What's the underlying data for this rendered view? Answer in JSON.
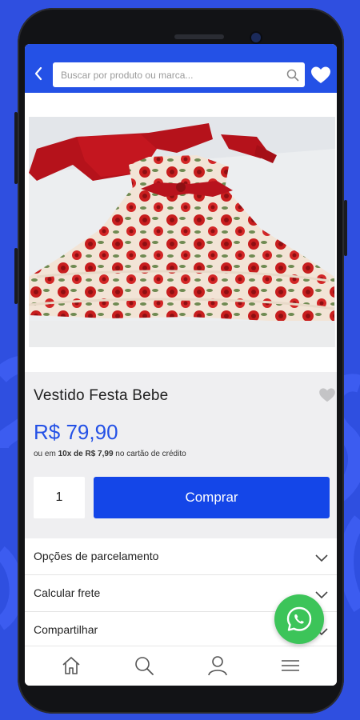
{
  "header": {
    "search_placeholder": "Buscar por produto ou marca..."
  },
  "product": {
    "name": "Vestido Festa Bebe",
    "price": "R$ 79,90",
    "installment_prefix": "ou em ",
    "installment_count": "10x de R$ 7,99",
    "installment_suffix": " no cartão de crédito",
    "quantity": "1",
    "buy_label": "Comprar"
  },
  "accordion": [
    {
      "label": "Opções de parcelamento"
    },
    {
      "label": "Calcular frete"
    },
    {
      "label": "Compartilhar"
    }
  ],
  "bottom_nav": [
    {
      "icon": "home-icon"
    },
    {
      "icon": "search-icon"
    },
    {
      "icon": "user-icon"
    },
    {
      "icon": "menu-icon"
    }
  ],
  "colors": {
    "primary": "#2451e6",
    "background": "#2f4fe0",
    "whatsapp": "#3cc459"
  }
}
